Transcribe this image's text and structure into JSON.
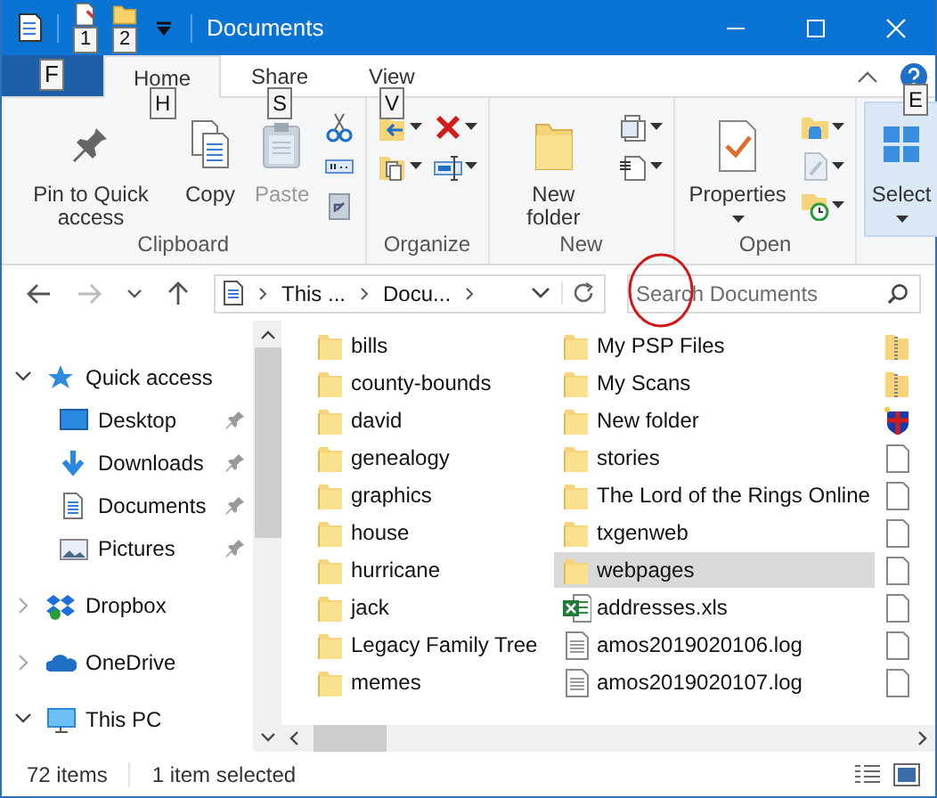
{
  "window": {
    "title": "Documents"
  },
  "quick_access_toolbar": [
    {
      "keytip": "1"
    },
    {
      "keytip": "2"
    }
  ],
  "file_tab": {
    "keytip": "F"
  },
  "tabs": [
    {
      "label": "Home",
      "selected": true,
      "keytip": "H"
    },
    {
      "label": "Share",
      "selected": false,
      "keytip": "S"
    },
    {
      "label": "View",
      "selected": false,
      "keytip": "V"
    }
  ],
  "help": {
    "keytip": "E"
  },
  "ribbon_groups": [
    {
      "label": "Clipboard",
      "items": [
        {
          "kind": "large",
          "label": "Pin to Quick access",
          "disabled": false,
          "dropdown": false,
          "highlighted": false
        },
        {
          "kind": "large",
          "label": "Copy",
          "disabled": false,
          "dropdown": false,
          "highlighted": false
        },
        {
          "kind": "large",
          "label": "Paste",
          "disabled": true,
          "dropdown": false,
          "highlighted": false
        },
        {
          "kind": "smallstack"
        }
      ]
    },
    {
      "label": "Organize",
      "items": [
        {
          "kind": "smallstack"
        },
        {
          "kind": "smallstack"
        }
      ]
    },
    {
      "label": "New",
      "items": [
        {
          "kind": "large",
          "label": "New folder",
          "disabled": false,
          "dropdown": false,
          "highlighted": false
        },
        {
          "kind": "smallstack"
        }
      ]
    },
    {
      "label": "Open",
      "items": [
        {
          "kind": "large",
          "label": "Properties",
          "disabled": false,
          "dropdown": true,
          "highlighted": false
        },
        {
          "kind": "smallstack"
        }
      ]
    },
    {
      "items": [
        {
          "kind": "large",
          "label": "Select",
          "disabled": false,
          "dropdown": true,
          "highlighted": true
        }
      ]
    }
  ],
  "address": {
    "crumbs": [
      "This ...",
      "Docu..."
    ]
  },
  "search": {
    "placeholder": "Search Documents"
  },
  "navigation": [
    {
      "label": "Quick access",
      "kind": "quick",
      "expanded": true,
      "children": [
        {
          "label": "Desktop",
          "kind": "desktop",
          "pinned": true
        },
        {
          "label": "Downloads",
          "kind": "downloads",
          "pinned": true
        },
        {
          "label": "Documents",
          "kind": "documents",
          "pinned": true
        },
        {
          "label": "Pictures",
          "kind": "pictures",
          "pinned": true
        }
      ]
    },
    {
      "label": "Dropbox",
      "kind": "dropbox",
      "expanded": false
    },
    {
      "label": "OneDrive",
      "kind": "onedrive",
      "expanded": false
    },
    {
      "label": "This PC",
      "kind": "pc",
      "expanded": true
    }
  ],
  "files": [
    {
      "name": "bills",
      "kind": "folder",
      "selected": false
    },
    {
      "name": "county-bounds",
      "kind": "folder",
      "selected": false
    },
    {
      "name": "david",
      "kind": "folder",
      "selected": false
    },
    {
      "name": "genealogy",
      "kind": "folder",
      "selected": false
    },
    {
      "name": "graphics",
      "kind": "folder",
      "selected": false
    },
    {
      "name": "house",
      "kind": "folder",
      "selected": false
    },
    {
      "name": "hurricane",
      "kind": "folder",
      "selected": false
    },
    {
      "name": "jack",
      "kind": "folder",
      "selected": false
    },
    {
      "name": "Legacy Family Tree",
      "kind": "folder",
      "selected": false
    },
    {
      "name": "memes",
      "kind": "folder",
      "selected": false
    },
    {
      "name": "My PSP Files",
      "kind": "folder",
      "selected": false
    },
    {
      "name": "My Scans",
      "kind": "folder",
      "selected": false
    },
    {
      "name": "New folder",
      "kind": "folder",
      "selected": false
    },
    {
      "name": "stories",
      "kind": "folder",
      "selected": false
    },
    {
      "name": "The Lord of the Rings Online",
      "kind": "folder",
      "selected": false
    },
    {
      "name": "txgenweb",
      "kind": "folder",
      "selected": false
    },
    {
      "name": "webpages",
      "kind": "folder",
      "selected": true
    },
    {
      "name": "addresses.xls",
      "kind": "spreadsheet",
      "selected": false
    },
    {
      "name": "amos2019020106.log",
      "kind": "text",
      "selected": false
    },
    {
      "name": "amos2019020107.log",
      "kind": "text",
      "selected": false
    },
    {
      "kind": "zip",
      "selected": false
    },
    {
      "kind": "zip",
      "selected": false
    },
    {
      "kind": "program",
      "selected": false
    },
    {
      "kind": "blank",
      "selected": false
    },
    {
      "kind": "blank",
      "selected": false
    },
    {
      "kind": "blank",
      "selected": false
    },
    {
      "kind": "blank",
      "selected": false
    },
    {
      "kind": "blank",
      "selected": false
    },
    {
      "kind": "blank",
      "selected": false
    },
    {
      "kind": "blank",
      "selected": false
    }
  ],
  "status_bar": {
    "count": "72 items",
    "selection": "1 item selected"
  }
}
